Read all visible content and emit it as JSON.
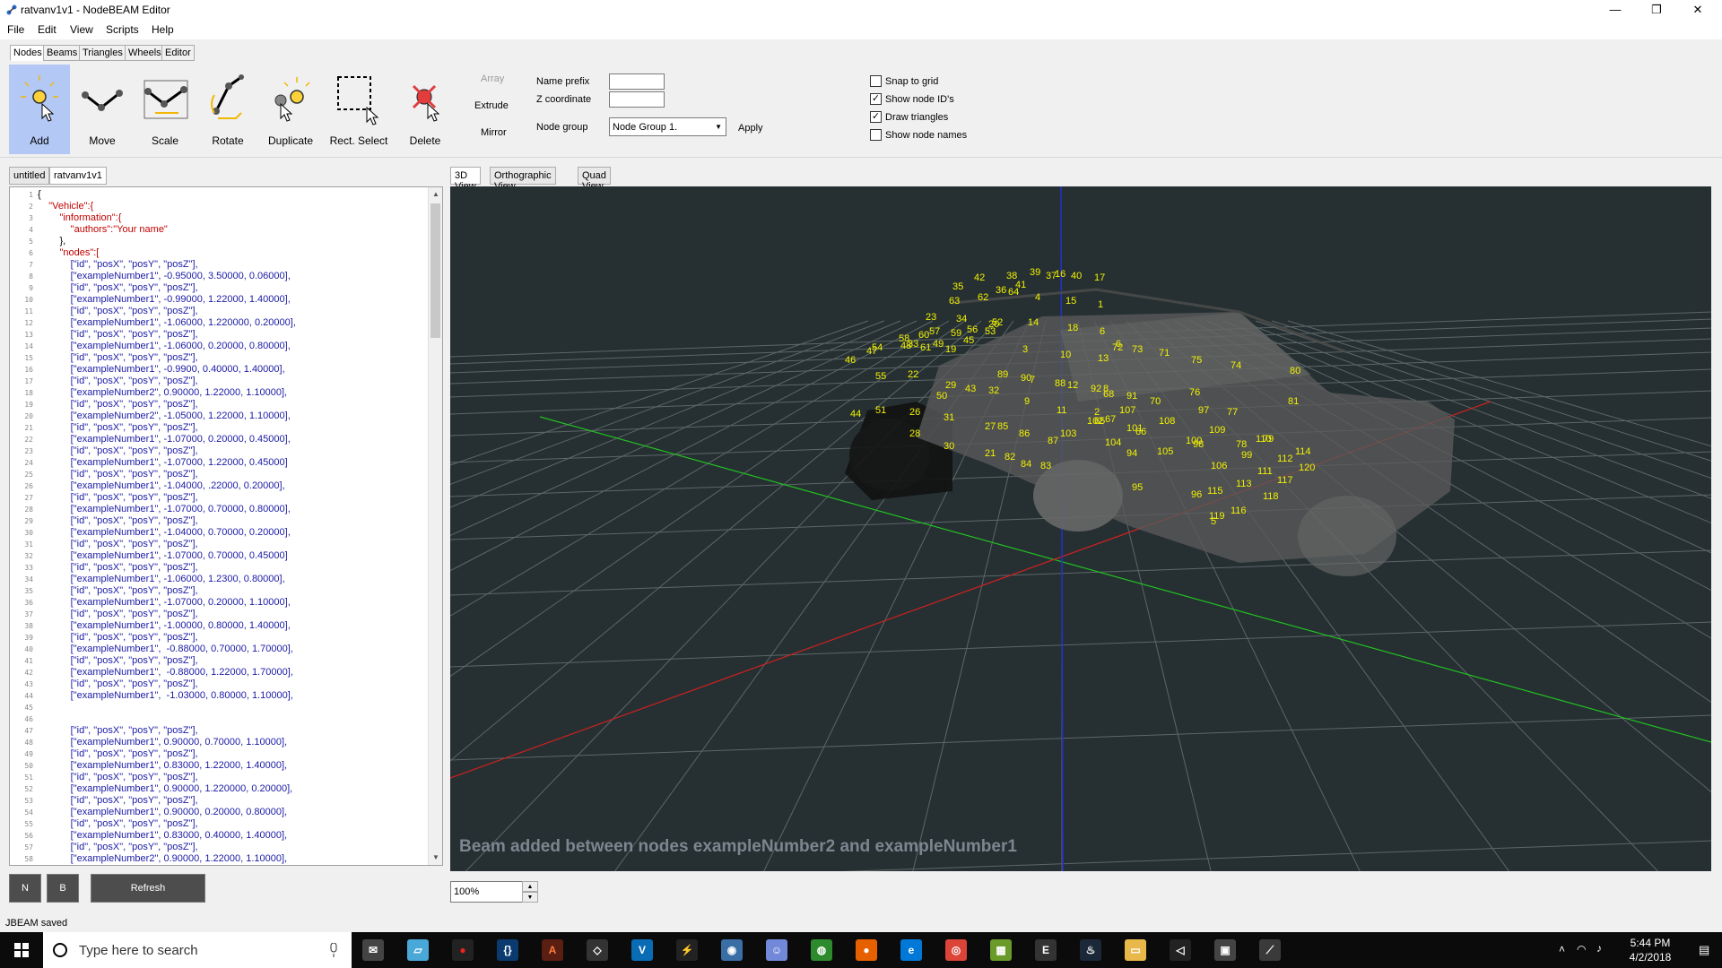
{
  "window": {
    "title": "ratvanv1v1 - NodeBEAM Editor",
    "min": "—",
    "max": "❐",
    "close": "✕"
  },
  "menu": [
    "File",
    "Edit",
    "View",
    "Scripts",
    "Help"
  ],
  "top_tabs": [
    "Nodes",
    "Beams",
    "Triangles",
    "Wheels",
    "Editor"
  ],
  "tools": [
    "Add",
    "Move",
    "Scale",
    "Rotate",
    "Duplicate",
    "Rect. Select",
    "Delete"
  ],
  "options": {
    "array": "Array",
    "extrude": "Extrude",
    "mirror": "Mirror",
    "name_prefix_label": "Name prefix",
    "name_prefix_value": "",
    "z_coord_label": "Z coordinate",
    "z_coord_value": "",
    "node_group_label": "Node group",
    "node_group_value": "Node Group 1.",
    "apply": "Apply"
  },
  "checkboxes": [
    {
      "label": "Snap to grid",
      "checked": false
    },
    {
      "label": "Show node ID's",
      "checked": true
    },
    {
      "label": "Draw triangles",
      "checked": true
    },
    {
      "label": "Show node names",
      "checked": false
    }
  ],
  "editor_tabs": [
    "untitled",
    "ratvanv1v1"
  ],
  "code_lines": [
    {
      "n": "1",
      "t": "{"
    },
    {
      "n": "2",
      "t": "    \"Vehicle\":{"
    },
    {
      "n": "3",
      "t": "        \"information\":{"
    },
    {
      "n": "4",
      "t": "            \"authors\":\"Your name\""
    },
    {
      "n": "5",
      "t": "        },"
    },
    {
      "n": "6",
      "t": "        \"nodes\":["
    },
    {
      "n": "7",
      "t": "            [\"id\", \"posX\", \"posY\", \"posZ\"],"
    },
    {
      "n": "8",
      "t": "            [\"exampleNumber1\", -0.95000, 3.50000, 0.06000],"
    },
    {
      "n": "9",
      "t": "            [\"id\", \"posX\", \"posY\", \"posZ\"],"
    },
    {
      "n": "10",
      "t": "            [\"exampleNumber1\", -0.99000, 1.22000, 1.40000],"
    },
    {
      "n": "11",
      "t": "            [\"id\", \"posX\", \"posY\", \"posZ\"],"
    },
    {
      "n": "12",
      "t": "            [\"exampleNumber1\", -1.06000, 1.220000, 0.20000],"
    },
    {
      "n": "13",
      "t": "            [\"id\", \"posX\", \"posY\", \"posZ\"],"
    },
    {
      "n": "14",
      "t": "            [\"exampleNumber1\", -1.06000, 0.20000, 0.80000],"
    },
    {
      "n": "15",
      "t": "            [\"id\", \"posX\", \"posY\", \"posZ\"],"
    },
    {
      "n": "16",
      "t": "            [\"exampleNumber1\", -0.9900, 0.40000, 1.40000],"
    },
    {
      "n": "17",
      "t": "            [\"id\", \"posX\", \"posY\", \"posZ\"],"
    },
    {
      "n": "18",
      "t": "            [\"exampleNumber2\", 0.90000, 1.22000, 1.10000],"
    },
    {
      "n": "19",
      "t": "            [\"id\", \"posX\", \"posY\", \"posZ\"],"
    },
    {
      "n": "20",
      "t": "            [\"exampleNumber2\", -1.05000, 1.22000, 1.10000],"
    },
    {
      "n": "21",
      "t": "            [\"id\", \"posX\", \"posY\", \"posZ\"],"
    },
    {
      "n": "22",
      "t": "            [\"exampleNumber1\", -1.07000, 0.20000, 0.45000],"
    },
    {
      "n": "23",
      "t": "            [\"id\", \"posX\", \"posY\", \"posZ\"],"
    },
    {
      "n": "24",
      "t": "            [\"exampleNumber1\", -1.07000, 1.22000, 0.45000]"
    },
    {
      "n": "25",
      "t": "            [\"id\", \"posX\", \"posY\", \"posZ\"],"
    },
    {
      "n": "26",
      "t": "            [\"exampleNumber1\", -1.04000, .22000, 0.20000],"
    },
    {
      "n": "27",
      "t": "            [\"id\", \"posX\", \"posY\", \"posZ\"],"
    },
    {
      "n": "28",
      "t": "            [\"exampleNumber1\", -1.07000, 0.70000, 0.80000],"
    },
    {
      "n": "29",
      "t": "            [\"id\", \"posX\", \"posY\", \"posZ\"],"
    },
    {
      "n": "30",
      "t": "            [\"exampleNumber1\", -1.04000, 0.70000, 0.20000],"
    },
    {
      "n": "31",
      "t": "            [\"id\", \"posX\", \"posY\", \"posZ\"],"
    },
    {
      "n": "32",
      "t": "            [\"exampleNumber1\", -1.07000, 0.70000, 0.45000]"
    },
    {
      "n": "33",
      "t": "            [\"id\", \"posX\", \"posY\", \"posZ\"],"
    },
    {
      "n": "34",
      "t": "            [\"exampleNumber1\", -1.06000, 1.2300, 0.80000],"
    },
    {
      "n": "35",
      "t": "            [\"id\", \"posX\", \"posY\", \"posZ\"],"
    },
    {
      "n": "36",
      "t": "            [\"exampleNumber1\", -1.07000, 0.20000, 1.10000],"
    },
    {
      "n": "37",
      "t": "            [\"id\", \"posX\", \"posY\", \"posZ\"],"
    },
    {
      "n": "38",
      "t": "            [\"exampleNumber1\", -1.00000, 0.80000, 1.40000],"
    },
    {
      "n": "39",
      "t": "            [\"id\", \"posX\", \"posY\", \"posZ\"],"
    },
    {
      "n": "40",
      "t": "            [\"exampleNumber1\",  -0.88000, 0.70000, 1.70000],"
    },
    {
      "n": "41",
      "t": "            [\"id\", \"posX\", \"posY\", \"posZ\"],"
    },
    {
      "n": "42",
      "t": "            [\"exampleNumber1\",  -0.88000, 1.22000, 1.70000],"
    },
    {
      "n": "43",
      "t": "            [\"id\", \"posX\", \"posY\", \"posZ\"],"
    },
    {
      "n": "44",
      "t": "            [\"exampleNumber1\",  -1.03000, 0.80000, 1.10000],"
    },
    {
      "n": "45",
      "t": ""
    },
    {
      "n": "46",
      "t": ""
    },
    {
      "n": "47",
      "t": "            [\"id\", \"posX\", \"posY\", \"posZ\"],"
    },
    {
      "n": "48",
      "t": "            [\"exampleNumber1\", 0.90000, 0.70000, 1.10000],"
    },
    {
      "n": "49",
      "t": "            [\"id\", \"posX\", \"posY\", \"posZ\"],"
    },
    {
      "n": "50",
      "t": "            [\"exampleNumber1\", 0.83000, 1.22000, 1.40000],"
    },
    {
      "n": "51",
      "t": "            [\"id\", \"posX\", \"posY\", \"posZ\"],"
    },
    {
      "n": "52",
      "t": "            [\"exampleNumber1\", 0.90000, 1.220000, 0.20000],"
    },
    {
      "n": "53",
      "t": "            [\"id\", \"posX\", \"posY\", \"posZ\"],"
    },
    {
      "n": "54",
      "t": "            [\"exampleNumber1\", 0.90000, 0.20000, 0.80000],"
    },
    {
      "n": "55",
      "t": "            [\"id\", \"posX\", \"posY\", \"posZ\"],"
    },
    {
      "n": "56",
      "t": "            [\"exampleNumber1\", 0.83000, 0.40000, 1.40000],"
    },
    {
      "n": "57",
      "t": "            [\"id\", \"posX\", \"posY\", \"posZ\"],"
    },
    {
      "n": "58",
      "t": "            [\"exampleNumber2\", 0.90000, 1.22000, 1.10000],"
    }
  ],
  "side_buttons": {
    "n": "N",
    "b": "B",
    "refresh": "Refresh"
  },
  "view_tabs": [
    "3D View",
    "Orthographic View",
    "Quad View"
  ],
  "viewport_message": "Beam added between nodes exampleNumber2 and exampleNumber1",
  "node_ids": [
    "42",
    "38",
    "39",
    "37",
    "16",
    "40",
    "17",
    "35",
    "36",
    "41",
    "63",
    "62",
    "64",
    "4",
    "15",
    "1",
    "23",
    "34",
    "6",
    "20",
    "14",
    "18",
    "57",
    "59",
    "56",
    "53",
    "60",
    "45",
    "58",
    "48",
    "33",
    "54",
    "49",
    "19",
    "46",
    "47",
    "6",
    "72",
    "73",
    "3",
    "10",
    "13",
    "71",
    "75",
    "74",
    "55",
    "22",
    "89",
    "90",
    "7",
    "88",
    "12",
    "92",
    "8",
    "68",
    "80",
    "50",
    "29",
    "43",
    "32",
    "9",
    "91",
    "70",
    "76",
    "81",
    "11",
    "2",
    "107",
    "97",
    "77",
    "26",
    "31",
    "27",
    "85",
    "86",
    "87",
    "103",
    "102",
    "65",
    "67",
    "101",
    "66",
    "108",
    "109",
    "44",
    "51",
    "28",
    "30",
    "104",
    "100",
    "98",
    "78",
    "110",
    "79",
    "114",
    "21",
    "82",
    "84",
    "83",
    "94",
    "105",
    "99",
    "112",
    "106",
    "120",
    "111",
    "117",
    "95",
    "113",
    "96",
    "115",
    "116",
    "118",
    "119",
    "5",
    "61",
    "52"
  ],
  "zoom": "100%",
  "status": "JBEAM saved",
  "taskbar": {
    "search_placeholder": "Type here to search",
    "time": "5:44 PM",
    "date": "4/2/2018"
  },
  "colors": {
    "viewport_bg": "#263032",
    "node_label": "#f2f200",
    "active_tool": "#b3c8f5"
  }
}
